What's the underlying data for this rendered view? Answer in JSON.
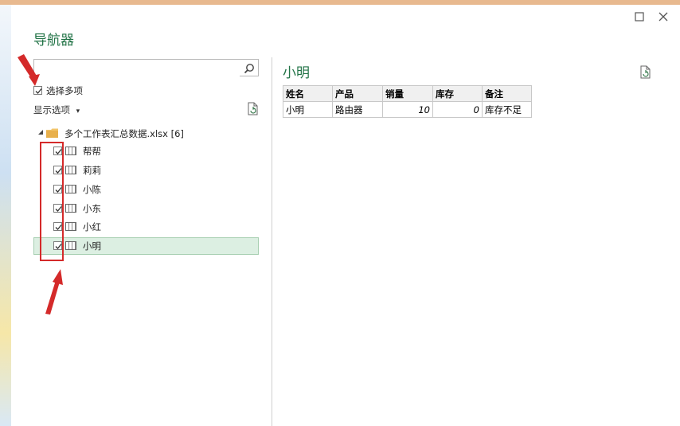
{
  "window": {
    "title": "导航器",
    "buttons": [
      "maximize-icon",
      "close-icon"
    ]
  },
  "left_panel": {
    "search": {
      "value": "",
      "placeholder": ""
    },
    "select_multiple": {
      "label": "选择多项",
      "checked": true
    },
    "display_options": {
      "label": "显示选项",
      "arrow": "▾"
    },
    "tree": {
      "root_label": "多个工作表汇总数据.xlsx [6]",
      "items": [
        {
          "label": "帮帮",
          "checked": true,
          "selected": false
        },
        {
          "label": "莉莉",
          "checked": true,
          "selected": false
        },
        {
          "label": "小陈",
          "checked": true,
          "selected": false
        },
        {
          "label": "小东",
          "checked": true,
          "selected": false
        },
        {
          "label": "小红",
          "checked": true,
          "selected": false
        },
        {
          "label": "小明",
          "checked": true,
          "selected": true
        }
      ]
    }
  },
  "preview": {
    "title": "小明",
    "columns": [
      "姓名",
      "产品",
      "销量",
      "库存",
      "备注"
    ],
    "rows": [
      [
        "小明",
        "路由器",
        "10",
        "0",
        "库存不足"
      ]
    ]
  },
  "colors": {
    "accent": "#217346",
    "annotation": "#d42a2a"
  }
}
